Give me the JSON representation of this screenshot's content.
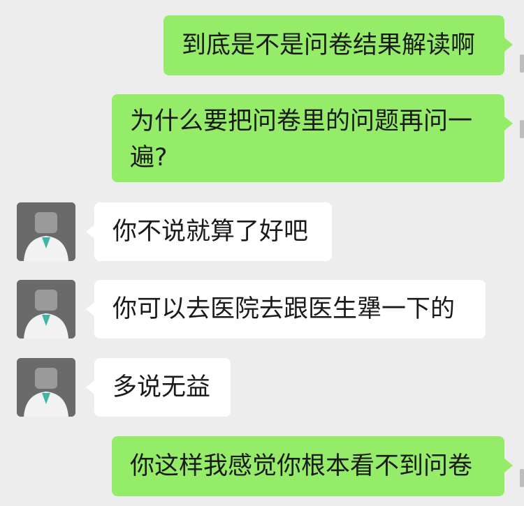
{
  "messages": [
    {
      "side": "out",
      "text": "到底是不是问卷结果解读啊"
    },
    {
      "side": "out",
      "text": "为什么要把问卷里的问题再问一遍?"
    },
    {
      "side": "in",
      "text": "你不说就算了好吧"
    },
    {
      "side": "in",
      "text": "你可以去医院去跟医生犟一下的"
    },
    {
      "side": "in",
      "text": "多说无益"
    },
    {
      "side": "out",
      "text": "你这样我感觉你根本看不到问卷"
    }
  ],
  "colors": {
    "background": "#ededed",
    "outgoing_bubble": "#95ec69",
    "incoming_bubble": "#ffffff",
    "text": "#1a1a1a"
  },
  "avatar_icon": "doctor-avatar"
}
